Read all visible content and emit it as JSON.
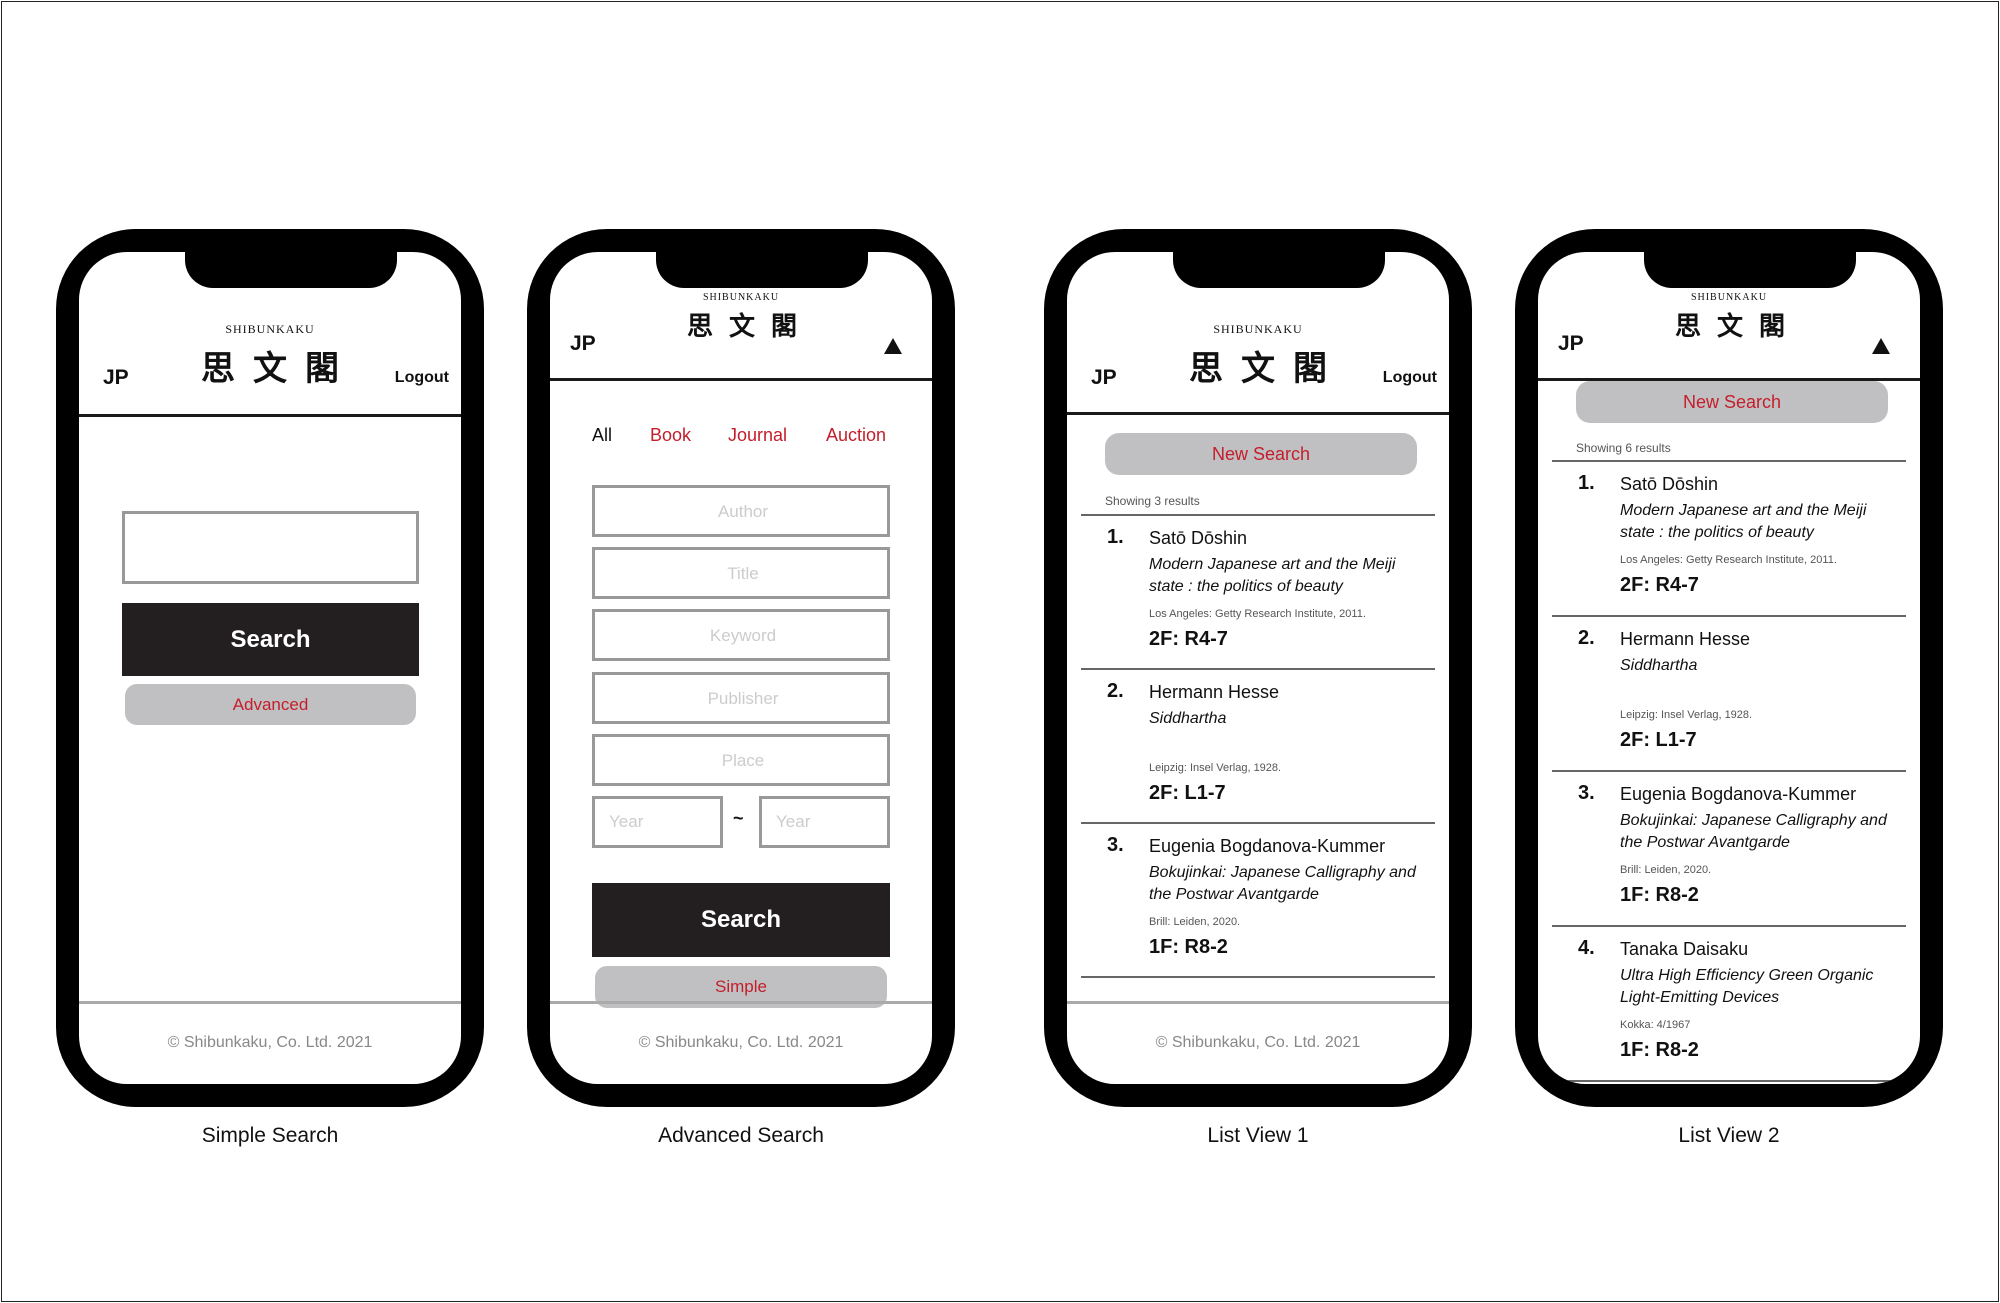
{
  "brand": {
    "romaji": "SHIBUNKAKU",
    "kanji": "思文閣"
  },
  "lang_toggle": "JP",
  "logout": "Logout",
  "copyright": "© Shibunkaku, Co. Ltd. 2021",
  "simple": {
    "search_value": "",
    "search_button": "Search",
    "advanced_button": "Advanced",
    "caption": "Simple Search"
  },
  "advanced": {
    "tabs": [
      "All",
      "Book",
      "Journal",
      "Auction"
    ],
    "active_tab": "All",
    "fields": {
      "author": "Author",
      "title": "Title",
      "keyword": "Keyword",
      "publisher": "Publisher",
      "place": "Place",
      "year_from": "Year",
      "year_to": "Year"
    },
    "year_separator": "~",
    "search_button": "Search",
    "simple_button": "Simple",
    "caption": "Advanced Search"
  },
  "list1": {
    "new_search": "New Search",
    "showing": "Showing 3 results",
    "caption": "List View 1"
  },
  "list2": {
    "new_search": "New Search",
    "showing": "Showing 6 results",
    "caption": "List View 2"
  },
  "results": [
    {
      "num": "1.",
      "author": "Satō Dōshin",
      "title": "Modern Japanese art and the Meiji state : the politics of beauty",
      "pub": "Los Angeles: Getty Research Institute, 2011.",
      "shelf": "2F: R4-7"
    },
    {
      "num": "2.",
      "author": "Hermann Hesse",
      "title": "Siddhartha",
      "pub": "Leipzig: Insel Verlag, 1928.",
      "shelf": "2F: L1-7"
    },
    {
      "num": "3.",
      "author": "Eugenia Bogdanova-Kummer",
      "title": "Bokujinkai: Japanese Calligraphy and the Postwar Avantgarde",
      "pub": "Brill: Leiden, 2020.",
      "shelf": "1F: R8-2"
    },
    {
      "num": "4.",
      "author": "Tanaka Daisaku",
      "title": "Ultra High Efficiency Green Organic Light-Emitting Devices",
      "pub": "Kokka: 4/1967",
      "shelf": "1F: R8-2"
    }
  ]
}
